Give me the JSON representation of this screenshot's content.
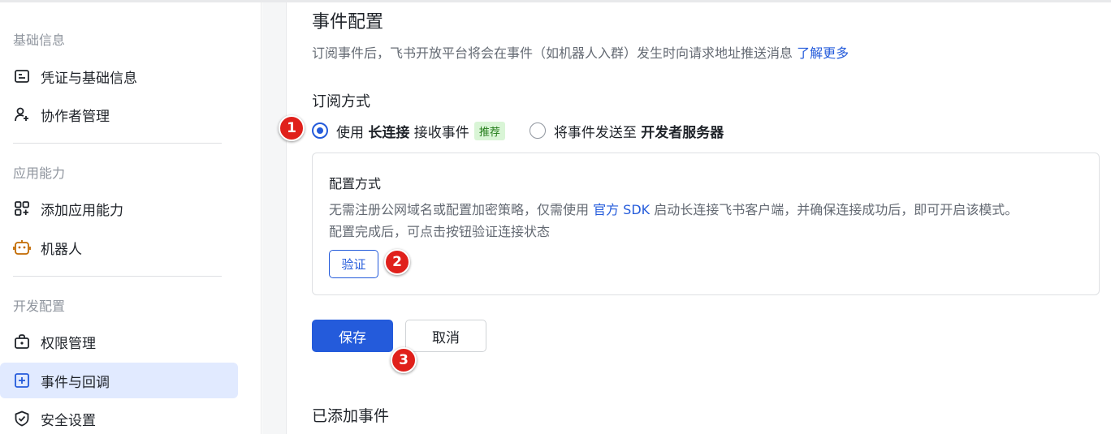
{
  "sidebar": {
    "sections": [
      {
        "title": "基础信息",
        "items": [
          {
            "label": "凭证与基础信息",
            "icon": "credential-icon"
          },
          {
            "label": "协作者管理",
            "icon": "add-collaborator-icon"
          }
        ]
      },
      {
        "title": "应用能力",
        "items": [
          {
            "label": "添加应用能力",
            "icon": "add-capability-icon"
          },
          {
            "label": "机器人",
            "icon": "robot-icon"
          }
        ]
      },
      {
        "title": "开发配置",
        "items": [
          {
            "label": "权限管理",
            "icon": "permission-icon"
          },
          {
            "label": "事件与回调",
            "icon": "event-callback-icon",
            "active": true
          },
          {
            "label": "安全设置",
            "icon": "shield-icon"
          }
        ]
      }
    ]
  },
  "main": {
    "title": "事件配置",
    "desc": "订阅事件后，飞书开放平台将会在事件（如机器人入群）发生时向请求地址推送消息",
    "learn_more": "了解更多",
    "subscribe_title": "订阅方式",
    "options": {
      "long_conn": {
        "prefix": "使用 ",
        "bold": "长连接",
        "suffix": " 接收事件",
        "tag": "推荐",
        "selected": true
      },
      "dev_server": {
        "prefix": "将事件发送至 ",
        "bold": "开发者服务器",
        "selected": false
      }
    },
    "config": {
      "title": "配置方式",
      "line1_a": "无需注册公网域名或配置加密策略，仅需使用 ",
      "line1_link": "官方 SDK",
      "line1_b": " 启动长连接飞书客户端，并确保连接成功后，即可开启该模式。",
      "line2": "配置完成后，可点击按钮验证连接状态",
      "verify_label": "验证"
    },
    "save_label": "保存",
    "cancel_label": "取消",
    "added_title": "已添加事件"
  },
  "markers": {
    "m1": "1",
    "m2": "2",
    "m3": "3"
  },
  "colors": {
    "primary": "#245bdb",
    "active_bg": "#e1eaff",
    "tag_bg": "#d9f5d6",
    "tag_text": "#237b19",
    "marker": "#e0201b"
  }
}
